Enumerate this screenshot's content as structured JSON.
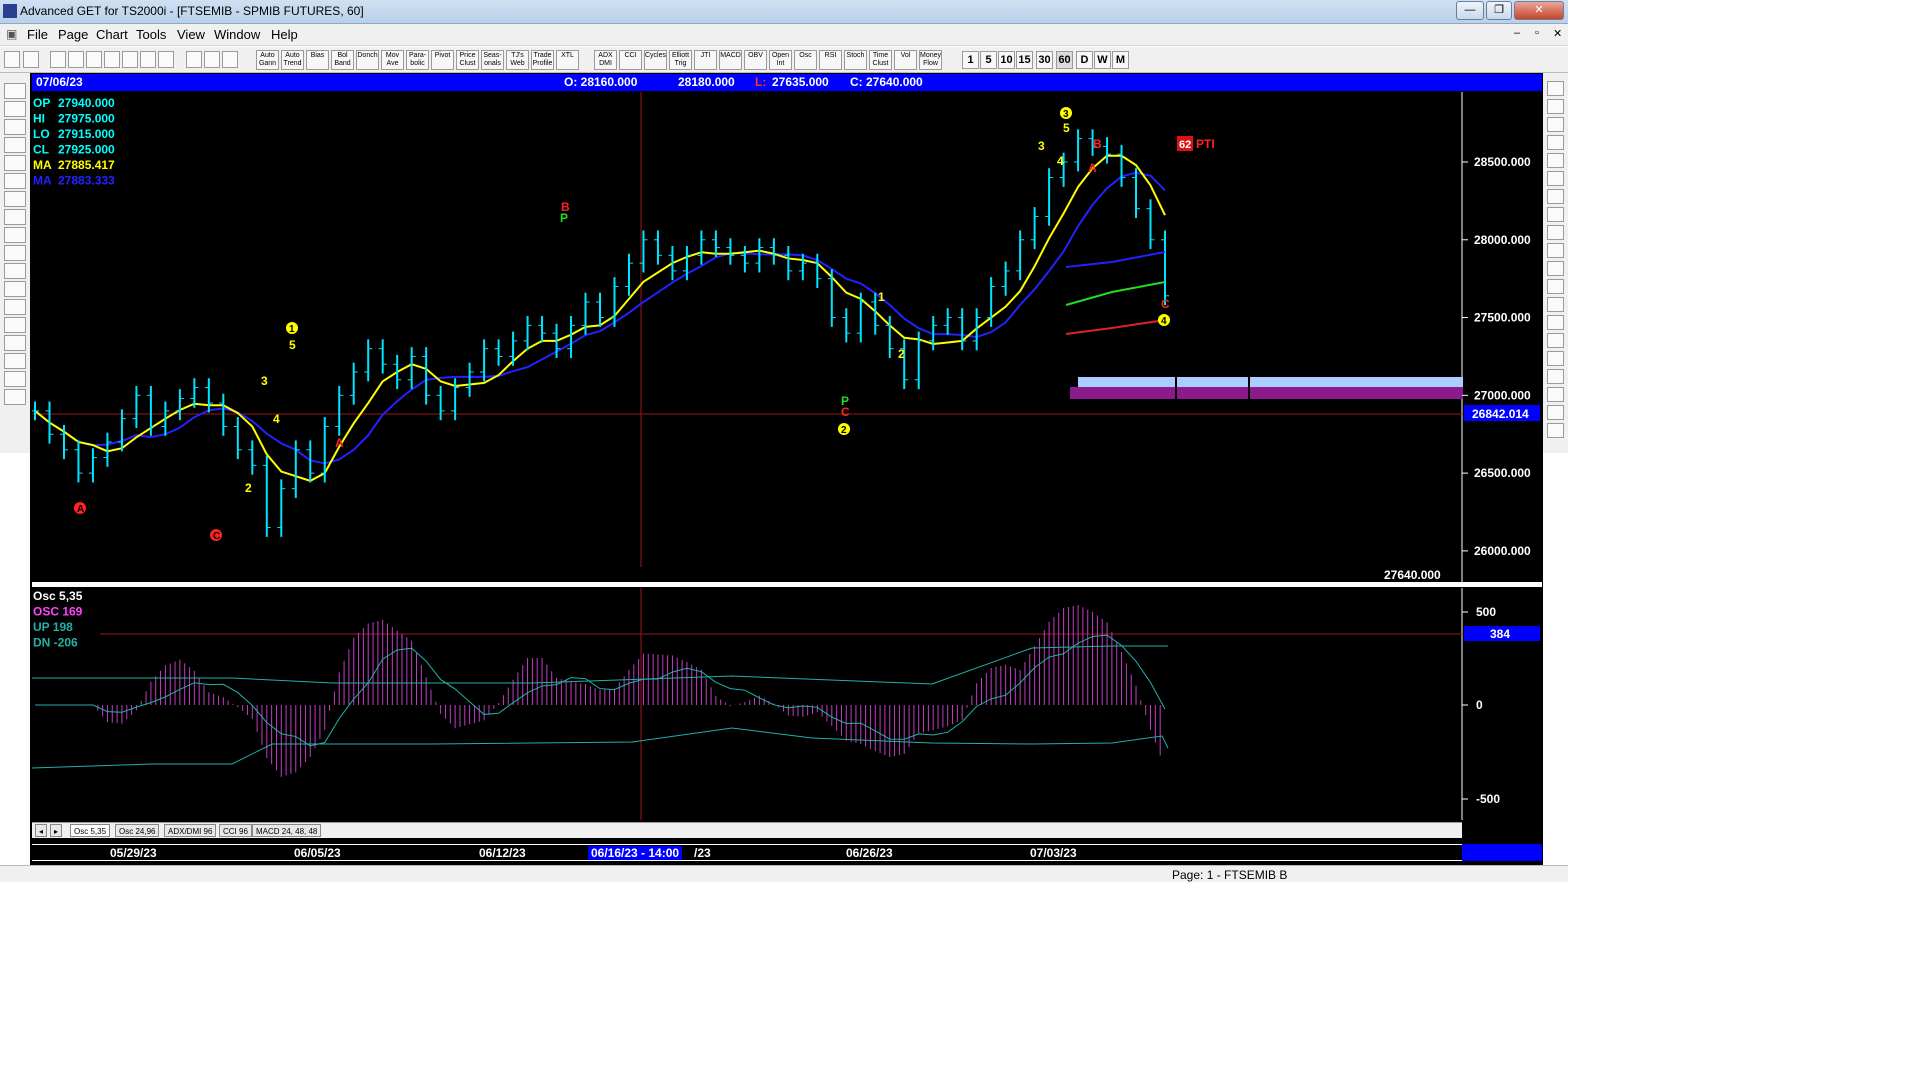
{
  "window": {
    "title": "Advanced GET for TS2000i - [FTSEMIB - SPMIB FUTURES, 60]",
    "minimize": "—",
    "restore": "❐",
    "close": "✕"
  },
  "menu": [
    "File",
    "Page",
    "Chart",
    "Tools",
    "View",
    "Window",
    "Help"
  ],
  "mdi": {
    "minimize": "–",
    "restore": "▫",
    "close": "✕"
  },
  "toolbar": {
    "labels": [
      "Auto\nGann",
      "Auto\nTrend",
      "Bias",
      "Bol\nBand",
      "Donch",
      "Mov\nAve",
      "Para-\nbolic",
      "Pivot",
      "Price\nClust",
      "Seas-\nonals",
      "TJ's\nWeb",
      "Trade\nProfile",
      "XTL",
      "ADX\nDMI",
      "CCI",
      "Cycles",
      "Elliott\nTrig",
      "JTI",
      "MACD",
      "OBV",
      "Open\nInt",
      "Osc",
      "RSI",
      "Stoch",
      "Time\nClust",
      "Vol",
      "Money\nFlow"
    ],
    "timeframes": [
      "1",
      "5",
      "10",
      "15",
      "30",
      "60",
      "D",
      "W",
      "M"
    ]
  },
  "header": {
    "date": "07/06/23",
    "open": "O: 28160.000",
    "high": "28180.000",
    "low": "L:",
    "low_val": "27635.000",
    "close": "C: 27640.000"
  },
  "readouts": [
    {
      "label": "OP",
      "value": "27940.000",
      "color": "#00ffff"
    },
    {
      "label": "HI",
      "value": "27975.000",
      "color": "#00ffff"
    },
    {
      "label": "LO",
      "value": "27915.000",
      "color": "#00ffff"
    },
    {
      "label": "CL",
      "value": "27925.000",
      "color": "#00ffff"
    },
    {
      "label": "MA",
      "value": "27885.417",
      "color": "#ffff00"
    },
    {
      "label": "MA",
      "value": "27883.333",
      "color": "#2222ff"
    }
  ],
  "price_axis": {
    "ticks": [
      "28500.000",
      "28000.000",
      "27500.000",
      "27000.000",
      "26500.000",
      "26000.000"
    ],
    "marker": "26842.014",
    "last": "27640.000"
  },
  "pti": {
    "value": "62",
    "label": "PTI"
  },
  "osc": {
    "readouts": [
      {
        "label": "Osc 5,35",
        "color": "#ffffff"
      },
      {
        "label": "OSC 169",
        "color": "#ff44ff"
      },
      {
        "label": "UP   198",
        "color": "#20b2aa"
      },
      {
        "label": "DN   -206",
        "color": "#20b2aa"
      }
    ],
    "ticks": [
      "500",
      "0",
      "-500"
    ],
    "marker": "384"
  },
  "osc_tabs": [
    "Osc 5,35",
    "Osc 24,96",
    "ADX/DMI 96",
    "CCI 96",
    "MACD 24, 48, 48"
  ],
  "dates": {
    "d1": "05/29/23",
    "d2": "06/05/23",
    "d3": "06/12/23",
    "cursor": "06/16/23 - 14:00",
    "d4": "/23",
    "d5": "06/26/23",
    "d6": "07/03/23"
  },
  "status": "Page: 1 - FTSEMIB B",
  "chart_data": {
    "type": "line",
    "ylim": [
      25800,
      28950
    ],
    "series": [
      {
        "values": [
          26900,
          26750,
          26650,
          26500,
          26600,
          26700,
          26850,
          27000,
          26800,
          26900,
          26980,
          27050,
          26950,
          26800,
          26650,
          26550,
          26150,
          26400,
          26650,
          26500,
          26800,
          27000,
          27150,
          27300,
          27200,
          27100,
          27250,
          27000,
          26900,
          27050,
          27150,
          27300,
          27250,
          27350,
          27450,
          27400,
          27300,
          27450,
          27600,
          27500,
          27700,
          27850,
          28000,
          27900,
          27800,
          27900,
          28000,
          27950,
          27900,
          27850,
          27950,
          27900,
          27800,
          27850,
          27750,
          27500,
          27400,
          27600,
          27450,
          27300,
          27100,
          27350,
          27450,
          27500,
          27350,
          27500,
          27700,
          27800,
          28000,
          28150,
          28400,
          28500,
          28650,
          28600,
          28550,
          28400,
          28200,
          28000,
          27640
        ]
      }
    ],
    "annotations": [
      "A",
      "C",
      "1",
      "5",
      "3",
      "4",
      "2",
      "A",
      "B",
      "P",
      "P",
      "C",
      "2",
      "1",
      "2",
      "3",
      "3",
      "5",
      "4",
      "B",
      "A",
      "C",
      "4"
    ]
  }
}
